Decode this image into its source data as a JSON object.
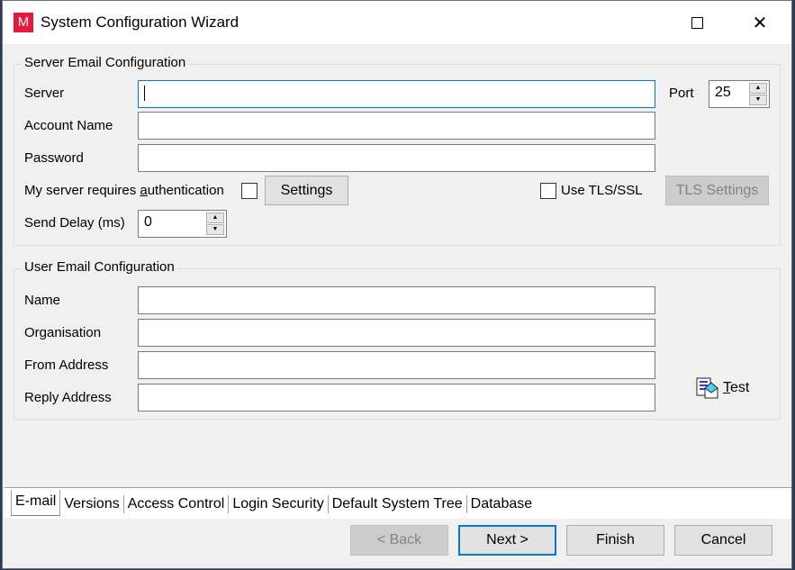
{
  "window": {
    "title": "System Configuration Wizard",
    "app_icon_letter": "M",
    "app_icon_color": "#e8173e",
    "maximize_icon": "maximize-icon",
    "close_icon": "close-icon",
    "close_glyph": "✕"
  },
  "server_group": {
    "label": "Server Email Configuration",
    "server_label": "Server",
    "server_value": "",
    "port_label": "Port",
    "port_value": "25",
    "account_label": "Account Name",
    "account_value": "",
    "password_label": "Password",
    "password_value": "",
    "auth_label_pre": "My server requires ",
    "auth_label_accel": "a",
    "auth_label_post": "uthentication",
    "auth_checked": false,
    "settings_button": "Settings",
    "tls_label": "Use TLS/SSL",
    "tls_checked": false,
    "tls_settings_button": "TLS Settings",
    "delay_label": "Send Delay (ms)",
    "delay_value": "0"
  },
  "user_group": {
    "label": "User Email Configuration",
    "name_label": "Name",
    "name_value": "",
    "org_label": "Organisation",
    "org_value": "",
    "from_label": "From Address",
    "from_value": "",
    "reply_label": "Reply Address",
    "reply_value": "",
    "test_accel": "T",
    "test_rest": "est",
    "test_icon": "mail-document-icon"
  },
  "tabs": [
    {
      "label": "E-mail",
      "active": true
    },
    {
      "label": "Versions",
      "active": false
    },
    {
      "label": "Access Control",
      "active": false
    },
    {
      "label": "Login Security",
      "active": false
    },
    {
      "label": "Default System Tree",
      "active": false
    },
    {
      "label": "Database",
      "active": false
    }
  ],
  "footer": {
    "back": "< Back",
    "next": "Next >",
    "finish": "Finish",
    "cancel": "Cancel"
  },
  "colors": {
    "focus": "#0078d7",
    "dialog_bg": "#f0f0f0"
  }
}
